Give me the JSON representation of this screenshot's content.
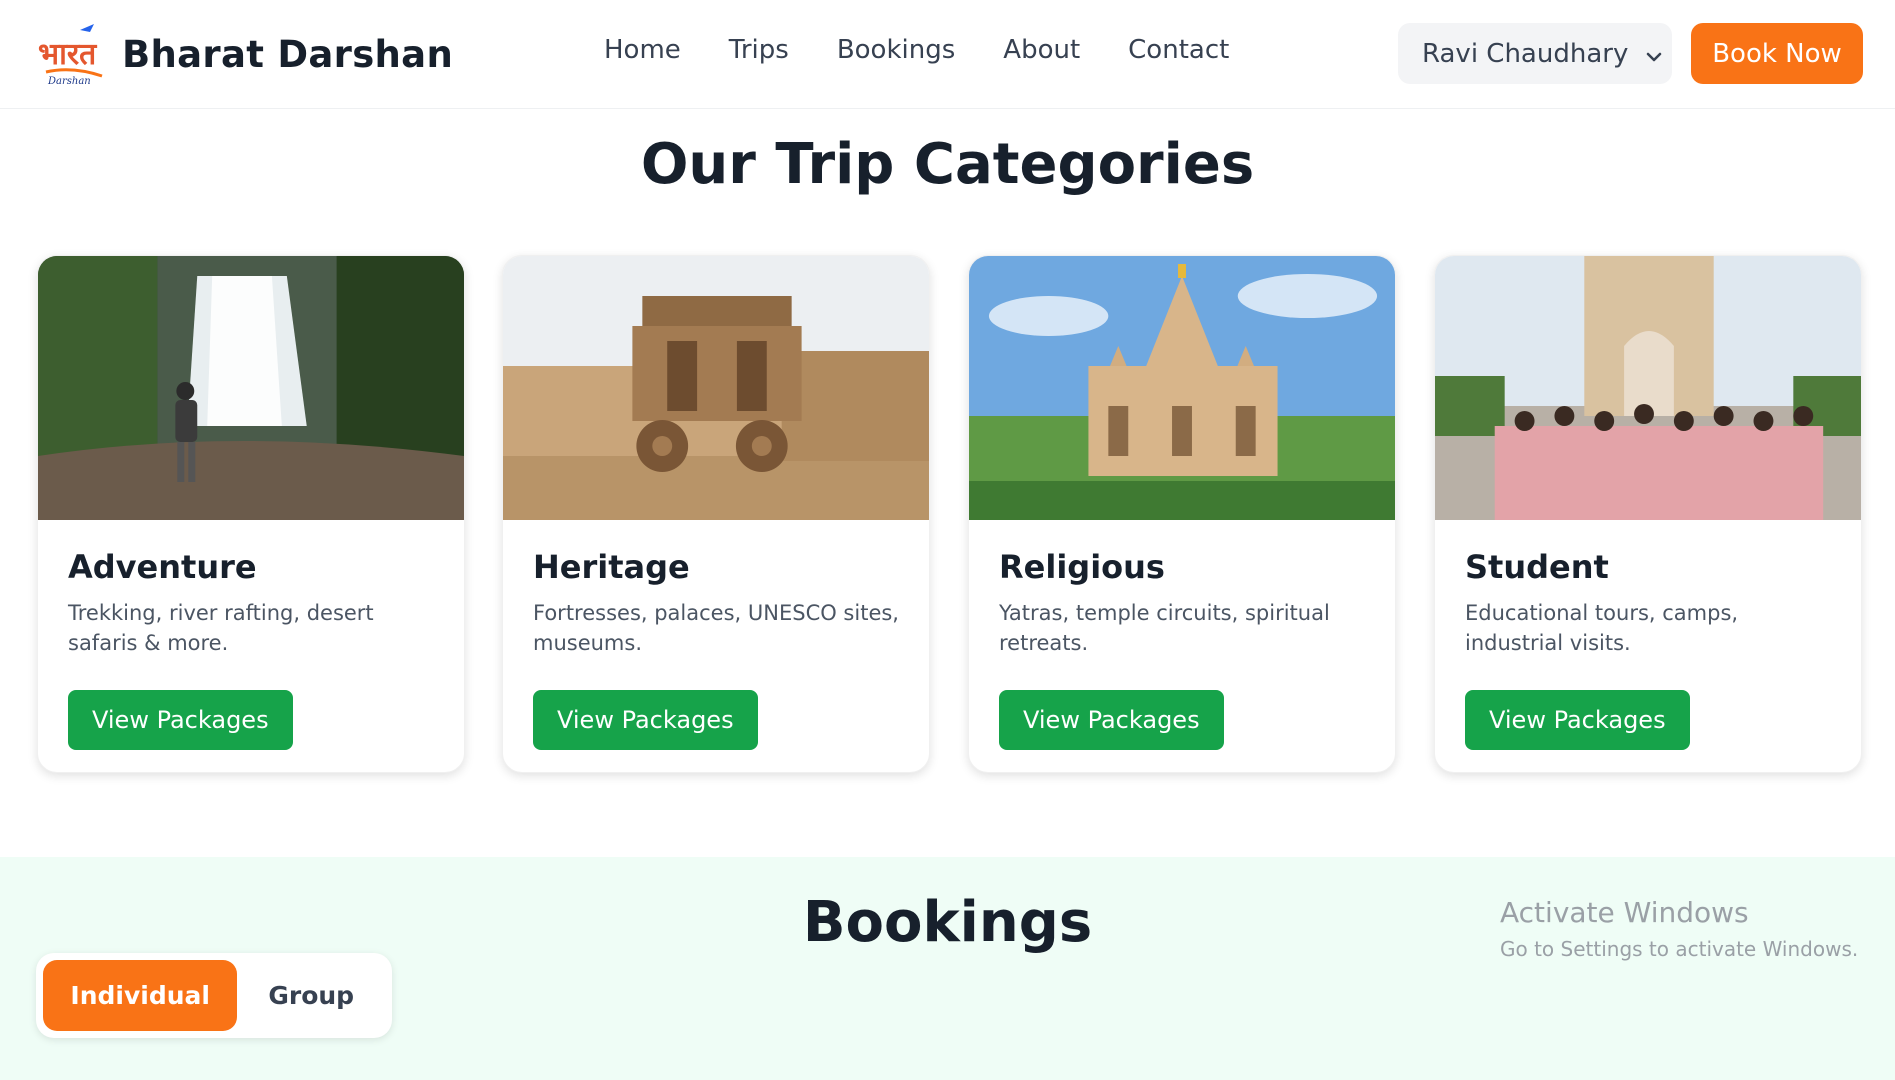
{
  "header": {
    "brand_name": "Bharat Darshan",
    "logo_text": "भारत",
    "logo_subtext": "Darshan",
    "nav": [
      "Home",
      "Trips",
      "Bookings",
      "About",
      "Contact"
    ],
    "user_name": "Ravi Chaudhary",
    "book_now": "Book Now"
  },
  "categories": {
    "title": "Our Trip Categories",
    "items": [
      {
        "title": "Adventure",
        "desc": "Trekking, river rafting, desert safaris & more.",
        "button": "View Packages"
      },
      {
        "title": "Heritage",
        "desc": "Fortresses, palaces, UNESCO sites, museums.",
        "button": "View Packages"
      },
      {
        "title": "Religious",
        "desc": "Yatras, temple circuits, spiritual retreats.",
        "button": "View Packages"
      },
      {
        "title": "Student",
        "desc": "Educational tours, camps, industrial visits.",
        "button": "View Packages"
      }
    ]
  },
  "bookings": {
    "title": "Bookings",
    "tabs": [
      "Individual",
      "Group"
    ],
    "active_tab": "Individual"
  },
  "watermark": {
    "line1": "Activate Windows",
    "line2": "Go to Settings to activate Windows."
  },
  "colors": {
    "accent_orange": "#f97316",
    "button_green": "#16a34a",
    "bookings_bg": "#effdf6",
    "heading": "#17202c"
  }
}
